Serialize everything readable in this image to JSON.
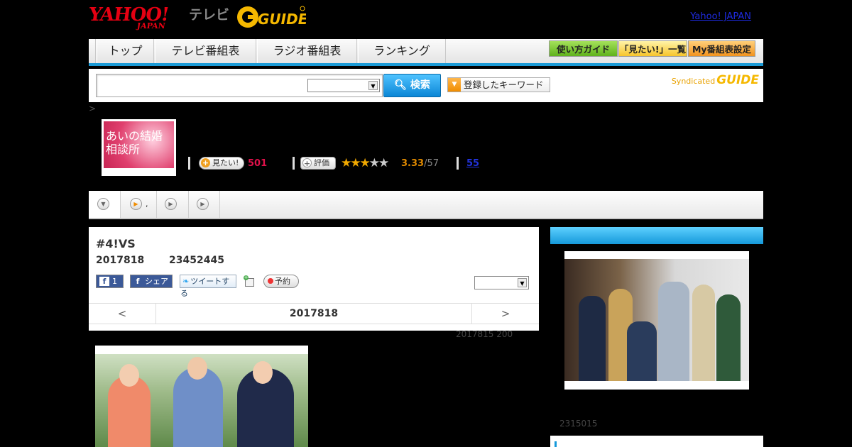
{
  "header": {
    "logo_yahoo": "YAHOO!",
    "logo_japan": "JAPAN",
    "logo_tv": "テレビ",
    "logo_gguide": "G-GUIDE",
    "yahoo_japan_link": "Yahoo! JAPAN"
  },
  "nav": {
    "tabs": [
      "トップ",
      "テレビ番組表",
      "ラジオ番組表",
      "ランキング"
    ],
    "guide_button": "使い方ガイド",
    "mitai_list_button": "「見たい!」一覧",
    "my_schedule_button": "My番組表設定"
  },
  "search": {
    "button_label": "検索",
    "keyword_button": "登録したキーワード",
    "syndicated_label": "Syndicated",
    "syndicated_logo": "GUIDE"
  },
  "breadcrumb": ">",
  "program": {
    "thumb_title": "あいの結婚相談所",
    "mitai_label": "見たい!",
    "mitai_count": "501",
    "rating_label": "評価",
    "rating_value": "3.33",
    "rating_count": "/57",
    "stars_on": 3,
    "stars_total": 5,
    "comment_count": "55"
  },
  "tabs_strip": {
    "tab2_suffix": ","
  },
  "episode": {
    "title": "#4!VS",
    "date": "2017818",
    "time": "23452445",
    "fb_count": "1",
    "fb_share": "シェア",
    "tweet": "ツイートする",
    "reserve": "予約",
    "pager_prev": "<",
    "pager_current": "2017818",
    "pager_next": ">"
  },
  "update_note": "2017815  200",
  "right_column": {
    "caption": "2315015"
  },
  "colors": {
    "accent_blue": "#1a9ad6",
    "rating_orange": "#e08a00",
    "mitai_red": "#e0114a",
    "yahoo_red": "#e60012"
  }
}
